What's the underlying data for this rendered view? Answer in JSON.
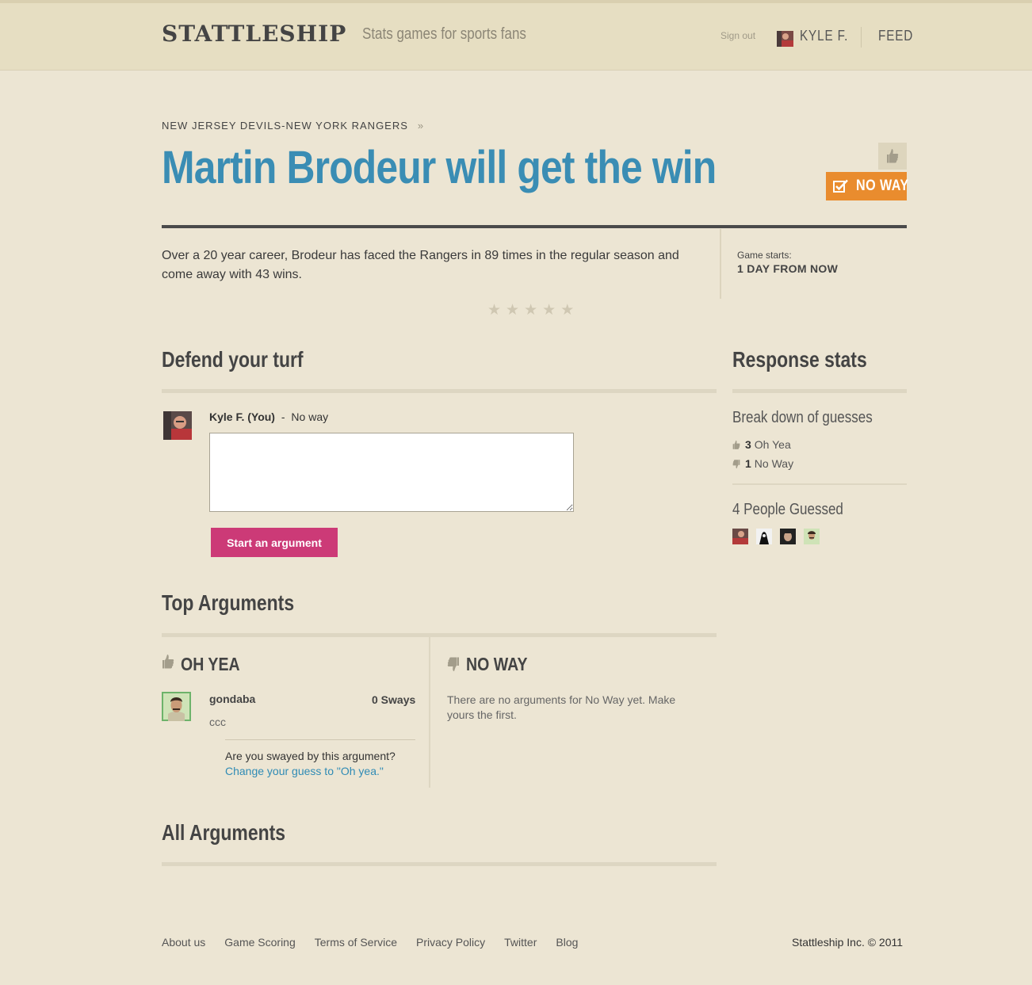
{
  "header": {
    "logo": "STATTLESHIP",
    "tagline": "Stats games for sports fans",
    "sign_out": "Sign out",
    "user_name": "KYLE F.",
    "feed": "FEED"
  },
  "game": {
    "breadcrumb": "NEW JERSEY DEVILS-NEW YORK RANGERS",
    "breadcrumb_sep": "»",
    "headline": "Martin Brodeur will get the win",
    "guess_badge": "NO WAY",
    "description": "Over a 20 year career, Brodeur has faced the Rangers in 89 times in the regular season and come away with 43 wins.",
    "game_starts_label": "Game starts:",
    "game_starts_value": "1 DAY FROM NOW",
    "rating_stars": 5
  },
  "defend": {
    "title": "Defend your turf",
    "user": "Kyle F. (You)",
    "separator": "-",
    "user_guess": "No way",
    "button": "Start an argument"
  },
  "top_arguments": {
    "title": "Top Arguments",
    "oh_yea": {
      "title": "OH YEA",
      "user": "gondaba",
      "sways": "0 Sways",
      "body": "ccc",
      "swayed_question": "Are you swayed by this argument?",
      "swayed_link": "Change your guess to \"Oh yea.\""
    },
    "no_way": {
      "title": "NO WAY",
      "empty": "There are no arguments for No Way yet. Make yours the first."
    }
  },
  "all_arguments": {
    "title": "All Arguments"
  },
  "stats": {
    "title": "Response stats",
    "breakdown_title": "Break down of guesses",
    "oh_yea_count": "3",
    "oh_yea_label": "Oh Yea",
    "no_way_count": "1",
    "no_way_label": "No Way",
    "people_title": "4 People Guessed",
    "people_count": 4
  },
  "footer": {
    "links": [
      "About us",
      "Game Scoring",
      "Terms of Service",
      "Privacy Policy",
      "Twitter",
      "Blog"
    ],
    "copyright": "Stattleship Inc. © 2011"
  },
  "colors": {
    "background": "#ece5d3",
    "headline_blue": "#3a8db4",
    "no_way_orange": "#e98c2e",
    "button_pink": "#cc3a77",
    "link_blue": "#2f8bb5"
  },
  "icons": [
    "thumbs-up-icon",
    "thumbs-down-icon",
    "checkbox-icon",
    "star-icon",
    "avatar"
  ]
}
